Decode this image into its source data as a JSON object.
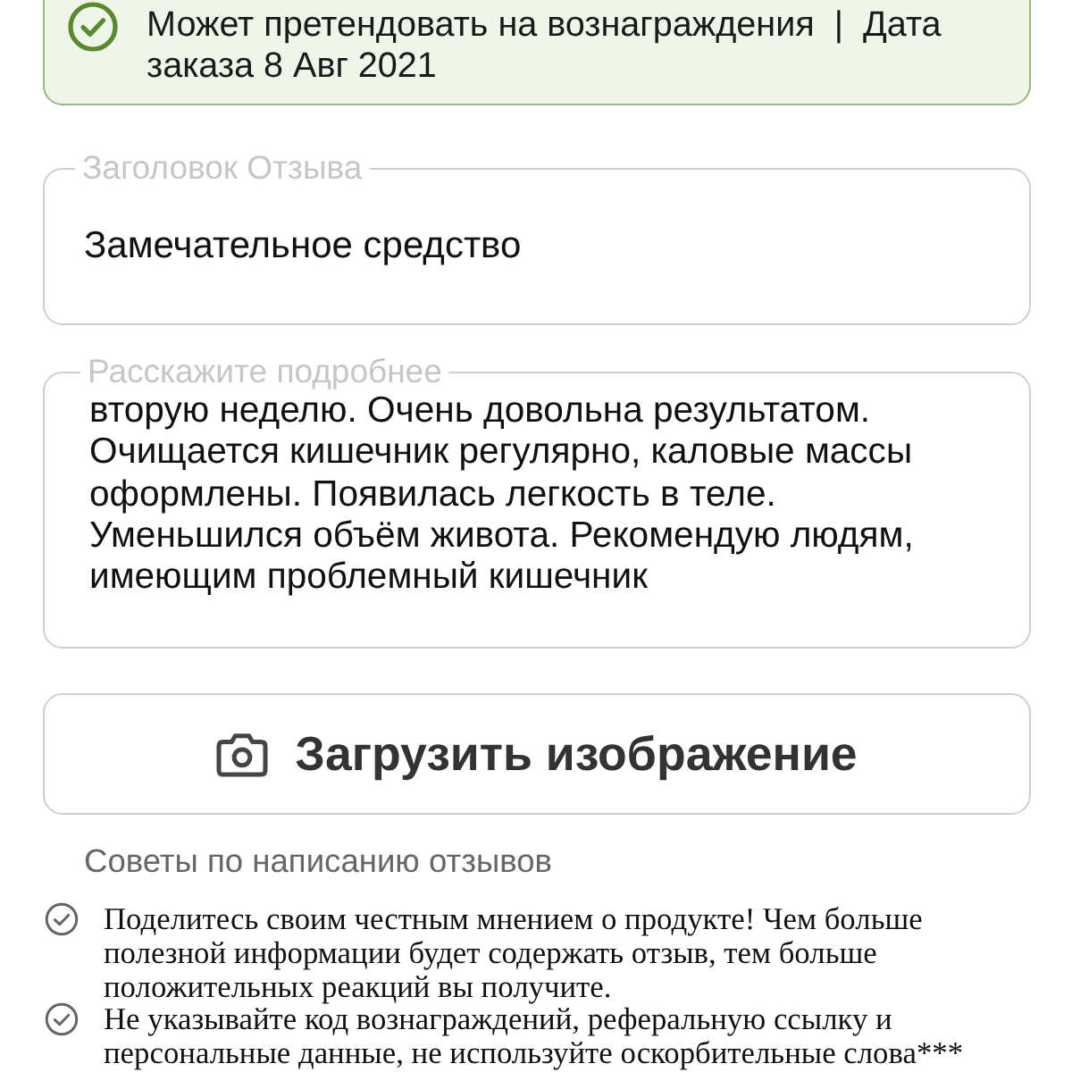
{
  "reward_banner": {
    "eligible": true,
    "text": "Может претендовать на вознаграждения  |  Дата заказа 8 Авг 2021"
  },
  "title_field": {
    "label": "Заголовок Отзыва",
    "value": "Замечательное средство"
  },
  "details_field": {
    "label": "Расскажите подробнее",
    "value": "вторую неделю. Очень довольна результатом. Очищается кишечник регулярно, каловые массы оформлены. Появилась легкость в теле. Уменьшился объём живота. Рекомендую людям, имеющим проблемный кишечник"
  },
  "upload_button": {
    "label": "Загрузить изображение"
  },
  "tips": {
    "heading": "Советы по написанию отзывов",
    "items": [
      {
        "text": "Поделитесь своим честным мнением о продукте! Чем больше полезной информации будет содержать отзыв, тем больше положительных реакций вы получите."
      },
      {
        "text": "Не указывайте код вознаграждений, реферальную ссылку и персональные данные, не используйте оскорбительные слова***"
      }
    ]
  }
}
